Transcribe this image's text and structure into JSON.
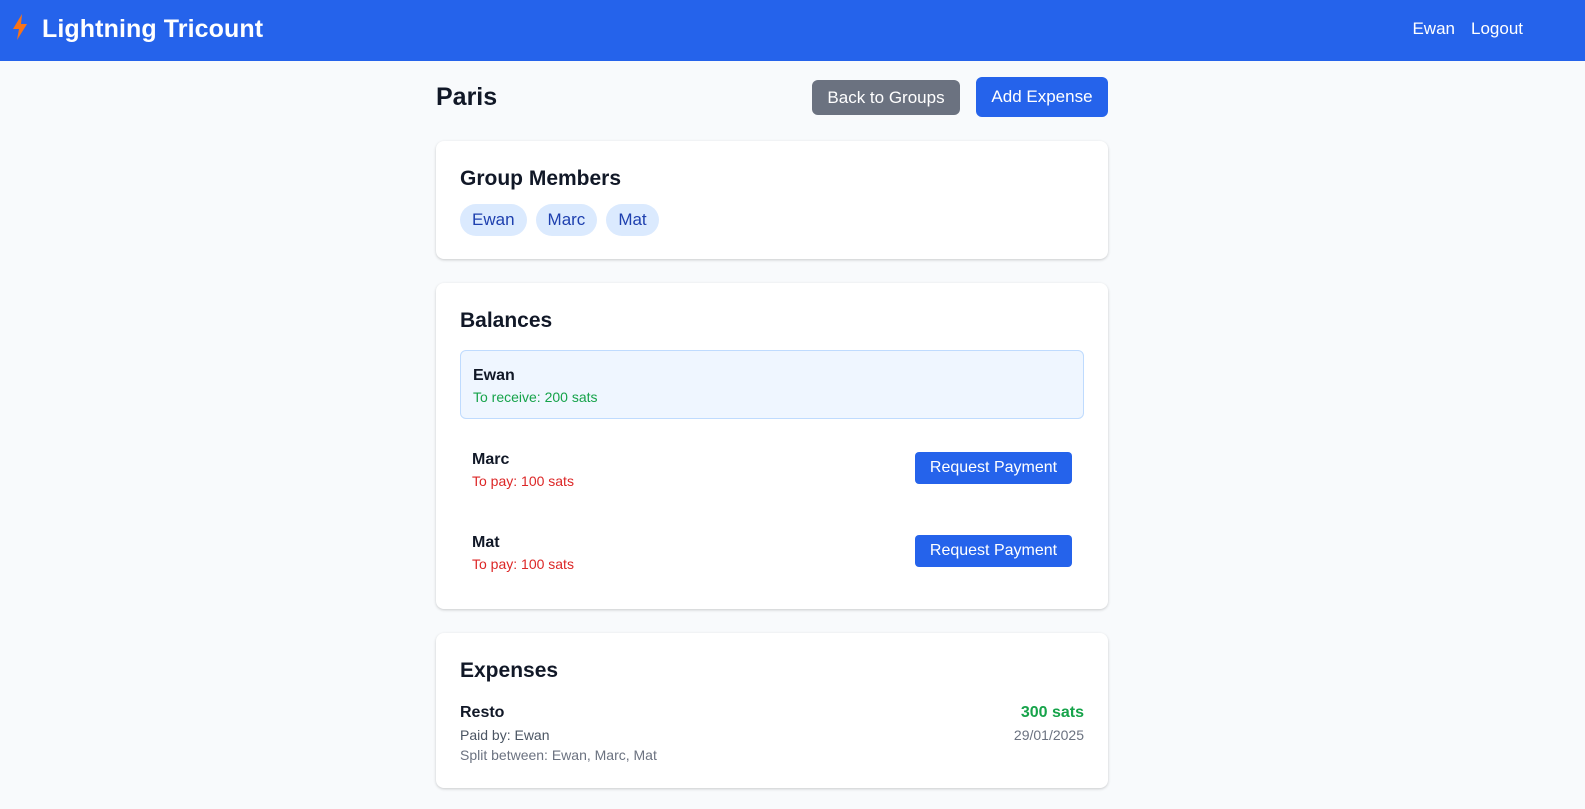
{
  "navbar": {
    "brand_icon": "lightning-bolt-icon",
    "brand_color": "#f97316",
    "title": "Lightning Tricount",
    "user": "Ewan",
    "logout": "Logout"
  },
  "page": {
    "group_name": "Paris",
    "back_label": "Back to Groups",
    "add_expense_label": "Add Expense"
  },
  "members": {
    "title": "Group Members",
    "list": [
      "Ewan",
      "Marc",
      "Mat"
    ]
  },
  "balances": {
    "title": "Balances",
    "rows": [
      {
        "name": "Ewan",
        "status": "To receive: 200 sats"
      },
      {
        "name": "Marc",
        "status": "To pay: 100 sats",
        "action": "Request Payment"
      },
      {
        "name": "Mat",
        "status": "To pay: 100 sats",
        "action": "Request Payment"
      }
    ]
  },
  "expenses": {
    "title": "Expenses",
    "items": [
      {
        "title": "Resto",
        "paid_by": "Paid by: Ewan",
        "split": "Split between: Ewan, Marc, Mat",
        "amount": "300 sats",
        "date": "29/01/2025"
      }
    ]
  },
  "colors": {
    "primary": "#2563eb",
    "secondary": "#6b7280",
    "positive": "#16a34a",
    "negative": "#dc2626"
  }
}
